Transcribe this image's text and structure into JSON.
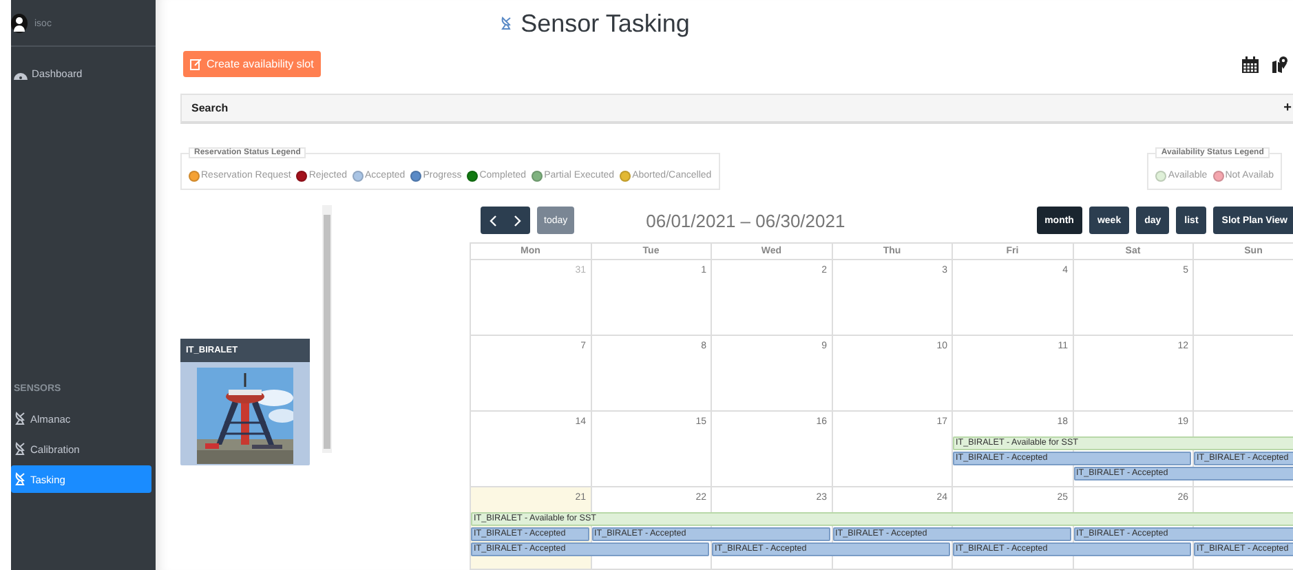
{
  "sidebar": {
    "user": {
      "name": "isoc"
    },
    "nav": [
      {
        "label": "Dashboard",
        "selected": false
      }
    ],
    "section_title": "SENSORS",
    "items": [
      {
        "label": "Almanac",
        "selected": false
      },
      {
        "label": "Calibration",
        "selected": false
      },
      {
        "label": "Tasking",
        "selected": true
      }
    ]
  },
  "page_title": "Sensor Tasking",
  "create_button": "Create availability slot",
  "search_panel": {
    "label": "Search",
    "toggle": "+"
  },
  "reservation_legend": {
    "title": "Reservation Status Legend",
    "items": [
      {
        "label": "Reservation Request",
        "color": "#f5a133"
      },
      {
        "label": "Rejected",
        "color": "#a3111c"
      },
      {
        "label": "Accepted",
        "color": "#a9c4e4"
      },
      {
        "label": "Progress",
        "color": "#5a8ac6"
      },
      {
        "label": "Completed",
        "color": "#127a12"
      },
      {
        "label": "Partial Executed",
        "color": "#7fb27f"
      },
      {
        "label": "Aborted/Cancelled",
        "color": "#e2b833"
      }
    ]
  },
  "availability_legend": {
    "title": "Availability Status Legend",
    "items": [
      {
        "label": "Available",
        "color": "#dff0d8"
      },
      {
        "label": "Not Availab",
        "color": "#f4a6ae"
      }
    ]
  },
  "sensors": [
    {
      "name": "IT_BIRALET",
      "kind": "picture"
    }
  ],
  "calendar": {
    "today_button": {
      "label": "today",
      "disabled": true
    },
    "range": "06/01/2021 – 06/30/2021",
    "views": [
      {
        "label": "month",
        "selected": true
      },
      {
        "label": "week",
        "selected": false
      },
      {
        "label": "day",
        "selected": false
      },
      {
        "label": "list",
        "selected": false
      },
      {
        "label": "Slot Plan View",
        "selected": false
      }
    ],
    "columns": [
      "Mon",
      "Tue",
      "Wed",
      "Thu",
      "Fri",
      "Sat",
      "Sun"
    ],
    "weeks": [
      {
        "days": [
          {
            "date": "31",
            "muted": true,
            "today": false
          },
          {
            "date": "1",
            "muted": false,
            "today": false
          },
          {
            "date": "2",
            "muted": false,
            "today": false
          },
          {
            "date": "3",
            "muted": false,
            "today": false
          },
          {
            "date": "4",
            "muted": false,
            "today": false
          },
          {
            "date": "5",
            "muted": false,
            "today": false
          }
        ]
      },
      {
        "days": [
          {
            "date": "7",
            "muted": false,
            "today": false
          },
          {
            "date": "8",
            "muted": false,
            "today": false
          },
          {
            "date": "9",
            "muted": false,
            "today": false
          },
          {
            "date": "10",
            "muted": false,
            "today": false
          },
          {
            "date": "11",
            "muted": false,
            "today": false
          },
          {
            "date": "12",
            "muted": false,
            "today": false
          }
        ]
      },
      {
        "days": [
          {
            "date": "14",
            "muted": false,
            "today": false
          },
          {
            "date": "15",
            "muted": false,
            "today": false
          },
          {
            "date": "16",
            "muted": false,
            "today": false
          },
          {
            "date": "17",
            "muted": false,
            "today": false
          },
          {
            "date": "18",
            "muted": false,
            "today": false
          },
          {
            "date": "19",
            "muted": false,
            "today": false
          }
        ],
        "lanes": [
          [
            {
              "kind": "empty"
            },
            {
              "kind": "empty"
            },
            {
              "kind": "empty"
            },
            {
              "kind": "empty"
            },
            {
              "kind": "available",
              "label": "IT_BIRALET - Available for SST"
            },
            {
              "kind": "more"
            },
            {
              "kind": "more"
            }
          ],
          [
            {
              "kind": "empty"
            },
            {
              "kind": "empty"
            },
            {
              "kind": "empty"
            },
            {
              "kind": "empty"
            },
            {
              "kind": "accepted",
              "label": "IT_BIRALET - Accepted"
            },
            {
              "kind": "more"
            },
            {
              "kind": "accepted",
              "label": "IT_BIRALET - Accepted"
            }
          ],
          [
            {
              "kind": "empty"
            },
            {
              "kind": "empty"
            },
            {
              "kind": "empty"
            },
            {
              "kind": "empty"
            },
            {
              "kind": "empty"
            },
            {
              "kind": "accepted",
              "label": "IT_BIRALET - Accepted"
            },
            {
              "kind": "more"
            }
          ]
        ]
      },
      {
        "days": [
          {
            "date": "21",
            "muted": false,
            "today": true
          },
          {
            "date": "22",
            "muted": false,
            "today": false
          },
          {
            "date": "23",
            "muted": false,
            "today": false
          },
          {
            "date": "24",
            "muted": false,
            "today": false
          },
          {
            "date": "25",
            "muted": false,
            "today": false
          },
          {
            "date": "26",
            "muted": false,
            "today": false
          }
        ],
        "lanes": [
          [
            {
              "kind": "available",
              "label": "IT_BIRALET - Available for SST"
            },
            {
              "kind": "more"
            },
            {
              "kind": "more"
            },
            {
              "kind": "more"
            },
            {
              "kind": "more"
            },
            {
              "kind": "more"
            },
            {
              "kind": "more"
            }
          ],
          [
            {
              "kind": "accepted",
              "label": "IT_BIRALET - Accepted"
            },
            {
              "kind": "accepted",
              "label": "IT_BIRALET - Accepted"
            },
            {
              "kind": "more"
            },
            {
              "kind": "accepted",
              "label": "IT_BIRALET - Accepted"
            },
            {
              "kind": "more"
            },
            {
              "kind": "accepted",
              "label": "IT_BIRALET - Accepted"
            },
            {
              "kind": "more"
            }
          ],
          [
            {
              "kind": "accepted",
              "label": "IT_BIRALET - Accepted"
            },
            {
              "kind": "more"
            },
            {
              "kind": "accepted",
              "label": "IT_BIRALET - Accepted"
            },
            {
              "kind": "more"
            },
            {
              "kind": "accepted",
              "label": "IT_BIRALET - Accepted"
            },
            {
              "kind": "more"
            },
            {
              "kind": "accepted",
              "label": "IT_BIRALET - Accepted"
            }
          ]
        ]
      }
    ]
  }
}
